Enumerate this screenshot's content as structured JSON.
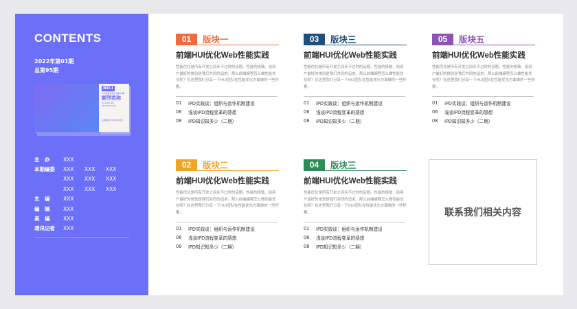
{
  "sidebar": {
    "title": "CONTENTS",
    "issue_line1": "2022年第01期",
    "issue_line2": "总第95期",
    "cover": {
      "badge": "NO.I",
      "sub": "HUI研发智慧分享第95期 2022年第01期",
      "name": "期刊名称",
      "en": "HUAWEI IPD TECHNOLOGY",
      "small": "主题报告 HUI优化专题"
    },
    "credits": [
      {
        "key": "主　办",
        "values": [
          "XXX"
        ]
      },
      {
        "key": "本期编委",
        "values": [
          "XXX",
          "XXX",
          "XXX"
        ]
      },
      {
        "key": "",
        "values": [
          "XXX",
          "XXX",
          "XXX"
        ]
      },
      {
        "key": "",
        "values": [
          "XXX",
          "XXX",
          "XXX"
        ]
      },
      {
        "key": "主　编",
        "values": [
          "XXX"
        ]
      },
      {
        "key": "编　辑",
        "values": [
          "XXX"
        ]
      },
      {
        "key": "美　编",
        "values": [
          "XXX"
        ]
      },
      {
        "key": "通讯记者",
        "values": [
          "XXX"
        ]
      }
    ]
  },
  "blocks": [
    {
      "num": "01",
      "label": "版块一",
      "color": "#ef6c3e",
      "title": "前端HUI优化Web性能实践",
      "desc": "性能优化是所有开发之间永不过时的话题。性能的极致，给用户最好的体验是我们共同的追求。那么前端编程怎么做性能优化呢？在这里我们分享一下HUI团队在性能优化方面做的一些积累。",
      "items": [
        {
          "n": "01",
          "t": "IPD实践谈：组织与运作机制建设"
        },
        {
          "n": "06",
          "t": "浅谈IPD流程变革的感想"
        },
        {
          "n": "08",
          "t": "IPD知识知多少（二期）"
        }
      ]
    },
    {
      "num": "02",
      "label": "版块二",
      "color": "#f0a528",
      "title": "前端HUI优化Web性能实践",
      "desc": "性能优化是所有开发之间永不过时的话题。性能的极致，给用户最好的体验是我们共同的追求。那么前端编程怎么做性能优化呢？在这里我们分享一下HUI团队在性能优化方面做的一些积累。",
      "items": [
        {
          "n": "01",
          "t": "IPD实践谈：组织与运作机制建设"
        },
        {
          "n": "06",
          "t": "浅谈IPD流程变革的感想"
        },
        {
          "n": "08",
          "t": "IPD知识知多少（二期）"
        }
      ]
    },
    {
      "num": "03",
      "label": "版块三",
      "color": "#1f4e79",
      "title": "前端HUI优化Web性能实践",
      "desc": "性能优化是所有开发之间永不过时的话题。性能的极致，给用户最好的体验是我们共同的追求。那么前端编程怎么做性能优化呢？在这里我们分享一下HUI团队在性能优化方面做的一些积累。",
      "items": [
        {
          "n": "01",
          "t": "IPD实践谈：组织与运作机制建设"
        },
        {
          "n": "06",
          "t": "浅谈IPD流程变革的感想"
        },
        {
          "n": "08",
          "t": "IPD知识知多少（二期）"
        }
      ]
    },
    {
      "num": "04",
      "label": "版块三",
      "color": "#2e8c58",
      "title": "前端HUI优化Web性能实践",
      "desc": "性能优化是所有开发之间永不过时的话题。性能的极致，给用户最好的体验是我们共同的追求。那么前端编程怎么做性能优化呢？在这里我们分享一下HUI团队在性能优化方面做的一些积累。",
      "items": [
        {
          "n": "01",
          "t": "IPD实践谈：组织与运作机制建设"
        },
        {
          "n": "06",
          "t": "浅谈IPD流程变革的感想"
        },
        {
          "n": "08",
          "t": "IPD知识知多少（二期）"
        }
      ]
    },
    {
      "num": "05",
      "label": "版块五",
      "color": "#8a55b3",
      "title": "前端HUI优化Web性能实践",
      "desc": "性能优化是所有开发之间永不过时的话题。性能的极致，给用户最好的体验是我们共同的追求。那么前端编程怎么做性能优化呢？在这里我们分享一下HUI团队在性能优化方面做的一些积累。",
      "items": [
        {
          "n": "01",
          "t": "IPD实践谈：组织与运作机制建设"
        },
        {
          "n": "06",
          "t": "浅谈IPD流程变革的感想"
        },
        {
          "n": "08",
          "t": "IPD知识知多少（二期）"
        }
      ]
    }
  ],
  "contact": "联系我们相关内容"
}
